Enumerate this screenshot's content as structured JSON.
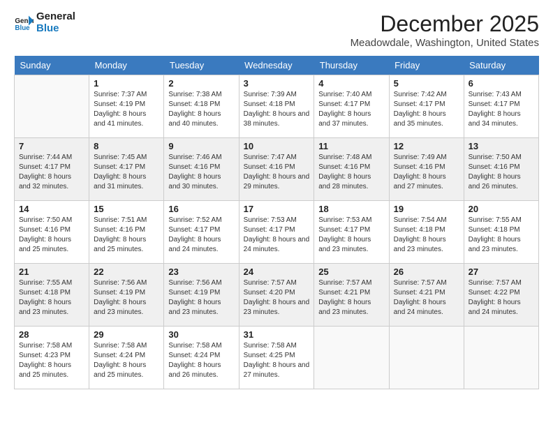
{
  "header": {
    "logo_line1": "General",
    "logo_line2": "Blue",
    "month": "December 2025",
    "location": "Meadowdale, Washington, United States"
  },
  "weekdays": [
    "Sunday",
    "Monday",
    "Tuesday",
    "Wednesday",
    "Thursday",
    "Friday",
    "Saturday"
  ],
  "weeks": [
    [
      {
        "day": "",
        "sunrise": "",
        "sunset": "",
        "daylight": ""
      },
      {
        "day": "1",
        "sunrise": "Sunrise: 7:37 AM",
        "sunset": "Sunset: 4:19 PM",
        "daylight": "Daylight: 8 hours and 41 minutes."
      },
      {
        "day": "2",
        "sunrise": "Sunrise: 7:38 AM",
        "sunset": "Sunset: 4:18 PM",
        "daylight": "Daylight: 8 hours and 40 minutes."
      },
      {
        "day": "3",
        "sunrise": "Sunrise: 7:39 AM",
        "sunset": "Sunset: 4:18 PM",
        "daylight": "Daylight: 8 hours and 38 minutes."
      },
      {
        "day": "4",
        "sunrise": "Sunrise: 7:40 AM",
        "sunset": "Sunset: 4:17 PM",
        "daylight": "Daylight: 8 hours and 37 minutes."
      },
      {
        "day": "5",
        "sunrise": "Sunrise: 7:42 AM",
        "sunset": "Sunset: 4:17 PM",
        "daylight": "Daylight: 8 hours and 35 minutes."
      },
      {
        "day": "6",
        "sunrise": "Sunrise: 7:43 AM",
        "sunset": "Sunset: 4:17 PM",
        "daylight": "Daylight: 8 hours and 34 minutes."
      }
    ],
    [
      {
        "day": "7",
        "sunrise": "Sunrise: 7:44 AM",
        "sunset": "Sunset: 4:17 PM",
        "daylight": "Daylight: 8 hours and 32 minutes."
      },
      {
        "day": "8",
        "sunrise": "Sunrise: 7:45 AM",
        "sunset": "Sunset: 4:17 PM",
        "daylight": "Daylight: 8 hours and 31 minutes."
      },
      {
        "day": "9",
        "sunrise": "Sunrise: 7:46 AM",
        "sunset": "Sunset: 4:16 PM",
        "daylight": "Daylight: 8 hours and 30 minutes."
      },
      {
        "day": "10",
        "sunrise": "Sunrise: 7:47 AM",
        "sunset": "Sunset: 4:16 PM",
        "daylight": "Daylight: 8 hours and 29 minutes."
      },
      {
        "day": "11",
        "sunrise": "Sunrise: 7:48 AM",
        "sunset": "Sunset: 4:16 PM",
        "daylight": "Daylight: 8 hours and 28 minutes."
      },
      {
        "day": "12",
        "sunrise": "Sunrise: 7:49 AM",
        "sunset": "Sunset: 4:16 PM",
        "daylight": "Daylight: 8 hours and 27 minutes."
      },
      {
        "day": "13",
        "sunrise": "Sunrise: 7:50 AM",
        "sunset": "Sunset: 4:16 PM",
        "daylight": "Daylight: 8 hours and 26 minutes."
      }
    ],
    [
      {
        "day": "14",
        "sunrise": "Sunrise: 7:50 AM",
        "sunset": "Sunset: 4:16 PM",
        "daylight": "Daylight: 8 hours and 25 minutes."
      },
      {
        "day": "15",
        "sunrise": "Sunrise: 7:51 AM",
        "sunset": "Sunset: 4:16 PM",
        "daylight": "Daylight: 8 hours and 25 minutes."
      },
      {
        "day": "16",
        "sunrise": "Sunrise: 7:52 AM",
        "sunset": "Sunset: 4:17 PM",
        "daylight": "Daylight: 8 hours and 24 minutes."
      },
      {
        "day": "17",
        "sunrise": "Sunrise: 7:53 AM",
        "sunset": "Sunset: 4:17 PM",
        "daylight": "Daylight: 8 hours and 24 minutes."
      },
      {
        "day": "18",
        "sunrise": "Sunrise: 7:53 AM",
        "sunset": "Sunset: 4:17 PM",
        "daylight": "Daylight: 8 hours and 23 minutes."
      },
      {
        "day": "19",
        "sunrise": "Sunrise: 7:54 AM",
        "sunset": "Sunset: 4:18 PM",
        "daylight": "Daylight: 8 hours and 23 minutes."
      },
      {
        "day": "20",
        "sunrise": "Sunrise: 7:55 AM",
        "sunset": "Sunset: 4:18 PM",
        "daylight": "Daylight: 8 hours and 23 minutes."
      }
    ],
    [
      {
        "day": "21",
        "sunrise": "Sunrise: 7:55 AM",
        "sunset": "Sunset: 4:18 PM",
        "daylight": "Daylight: 8 hours and 23 minutes."
      },
      {
        "day": "22",
        "sunrise": "Sunrise: 7:56 AM",
        "sunset": "Sunset: 4:19 PM",
        "daylight": "Daylight: 8 hours and 23 minutes."
      },
      {
        "day": "23",
        "sunrise": "Sunrise: 7:56 AM",
        "sunset": "Sunset: 4:19 PM",
        "daylight": "Daylight: 8 hours and 23 minutes."
      },
      {
        "day": "24",
        "sunrise": "Sunrise: 7:57 AM",
        "sunset": "Sunset: 4:20 PM",
        "daylight": "Daylight: 8 hours and 23 minutes."
      },
      {
        "day": "25",
        "sunrise": "Sunrise: 7:57 AM",
        "sunset": "Sunset: 4:21 PM",
        "daylight": "Daylight: 8 hours and 23 minutes."
      },
      {
        "day": "26",
        "sunrise": "Sunrise: 7:57 AM",
        "sunset": "Sunset: 4:21 PM",
        "daylight": "Daylight: 8 hours and 24 minutes."
      },
      {
        "day": "27",
        "sunrise": "Sunrise: 7:57 AM",
        "sunset": "Sunset: 4:22 PM",
        "daylight": "Daylight: 8 hours and 24 minutes."
      }
    ],
    [
      {
        "day": "28",
        "sunrise": "Sunrise: 7:58 AM",
        "sunset": "Sunset: 4:23 PM",
        "daylight": "Daylight: 8 hours and 25 minutes."
      },
      {
        "day": "29",
        "sunrise": "Sunrise: 7:58 AM",
        "sunset": "Sunset: 4:24 PM",
        "daylight": "Daylight: 8 hours and 25 minutes."
      },
      {
        "day": "30",
        "sunrise": "Sunrise: 7:58 AM",
        "sunset": "Sunset: 4:24 PM",
        "daylight": "Daylight: 8 hours and 26 minutes."
      },
      {
        "day": "31",
        "sunrise": "Sunrise: 7:58 AM",
        "sunset": "Sunset: 4:25 PM",
        "daylight": "Daylight: 8 hours and 27 minutes."
      },
      {
        "day": "",
        "sunrise": "",
        "sunset": "",
        "daylight": ""
      },
      {
        "day": "",
        "sunrise": "",
        "sunset": "",
        "daylight": ""
      },
      {
        "day": "",
        "sunrise": "",
        "sunset": "",
        "daylight": ""
      }
    ]
  ]
}
